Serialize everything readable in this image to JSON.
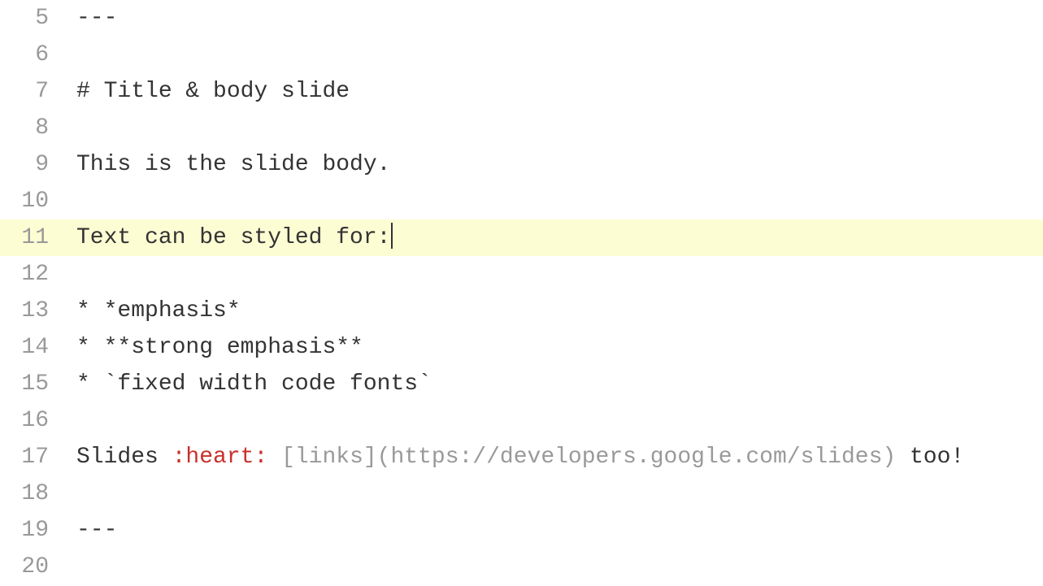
{
  "editor": {
    "activeLine": 11,
    "lines": [
      {
        "num": 5,
        "tokens": [
          {
            "t": "---"
          }
        ]
      },
      {
        "num": 6,
        "tokens": []
      },
      {
        "num": 7,
        "tokens": [
          {
            "t": "# Title & body slide"
          }
        ]
      },
      {
        "num": 8,
        "tokens": []
      },
      {
        "num": 9,
        "tokens": [
          {
            "t": "This is the slide body."
          }
        ]
      },
      {
        "num": 10,
        "tokens": []
      },
      {
        "num": 11,
        "tokens": [
          {
            "t": "Text can be styled for:"
          }
        ],
        "cursor": true
      },
      {
        "num": 12,
        "tokens": []
      },
      {
        "num": 13,
        "tokens": [
          {
            "t": "* *emphasis*"
          }
        ]
      },
      {
        "num": 14,
        "tokens": [
          {
            "t": "* **strong emphasis**"
          }
        ]
      },
      {
        "num": 15,
        "tokens": [
          {
            "t": "* `fixed width code fonts`"
          }
        ]
      },
      {
        "num": 16,
        "tokens": []
      },
      {
        "num": 17,
        "tokens": [
          {
            "t": "Slides "
          },
          {
            "t": ":heart:",
            "cls": "emoji-kw"
          },
          {
            "t": " "
          },
          {
            "t": "[links](https://developers.google.com/slides)",
            "cls": "link-md"
          },
          {
            "t": " too!"
          }
        ]
      },
      {
        "num": 18,
        "tokens": []
      },
      {
        "num": 19,
        "tokens": [
          {
            "t": "---"
          }
        ]
      },
      {
        "num": 20,
        "tokens": []
      }
    ]
  }
}
